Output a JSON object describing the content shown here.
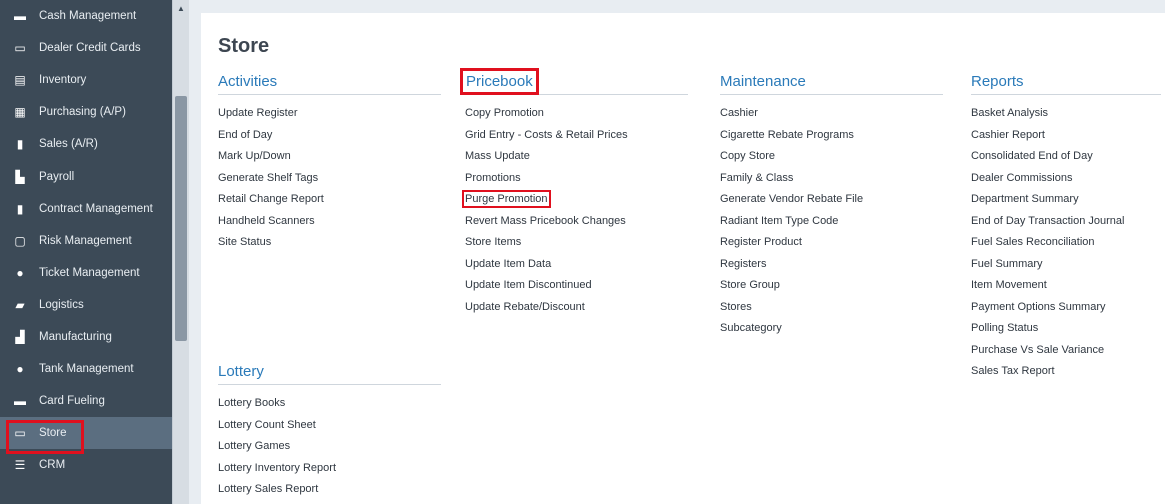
{
  "sidebar": {
    "items": [
      {
        "label": "Cash Management",
        "icon": "cash-icon",
        "glyph": "▬"
      },
      {
        "label": "Dealer Credit Cards",
        "icon": "credit-card-icon",
        "glyph": "▭"
      },
      {
        "label": "Inventory",
        "icon": "inventory-icon",
        "glyph": "▤"
      },
      {
        "label": "Purchasing (A/P)",
        "icon": "purchasing-icon",
        "glyph": "▦"
      },
      {
        "label": "Sales (A/R)",
        "icon": "sales-icon",
        "glyph": "▮"
      },
      {
        "label": "Payroll",
        "icon": "payroll-icon",
        "glyph": "▙"
      },
      {
        "label": "Contract Management",
        "icon": "contract-icon",
        "glyph": "▮"
      },
      {
        "label": "Risk Management",
        "icon": "risk-icon",
        "glyph": "▢"
      },
      {
        "label": "Ticket Management",
        "icon": "map-pin-icon",
        "glyph": "●"
      },
      {
        "label": "Logistics",
        "icon": "truck-icon",
        "glyph": "▰"
      },
      {
        "label": "Manufacturing",
        "icon": "factory-icon",
        "glyph": "▟"
      },
      {
        "label": "Tank Management",
        "icon": "fuel-drop-icon",
        "glyph": "●"
      },
      {
        "label": "Card Fueling",
        "icon": "card-icon",
        "glyph": "▬"
      },
      {
        "label": "Store",
        "icon": "store-icon",
        "glyph": "▭",
        "active": true
      },
      {
        "label": "CRM",
        "icon": "list-icon",
        "glyph": "☰"
      }
    ]
  },
  "page": {
    "title": "Store"
  },
  "sections": {
    "activities": {
      "title": "Activities",
      "links": [
        "Update Register",
        "End of Day",
        "Mark Up/Down",
        "Generate Shelf Tags",
        "Retail Change Report",
        "Handheld Scanners",
        "Site Status"
      ]
    },
    "pricebook": {
      "title": "Pricebook",
      "links": [
        "Copy Promotion",
        "Grid Entry - Costs & Retail Prices",
        "Mass Update",
        "Promotions",
        "Purge Promotion",
        "Revert Mass Pricebook Changes",
        "Store Items",
        "Update Item Data",
        "Update Item Discontinued",
        "Update Rebate/Discount"
      ]
    },
    "maintenance": {
      "title": "Maintenance",
      "links": [
        "Cashier",
        "Cigarette Rebate Programs",
        "Copy Store",
        "Family & Class",
        "Generate Vendor Rebate File",
        "Radiant Item Type Code",
        "Register Product",
        "Registers",
        "Store Group",
        "Stores",
        "Subcategory"
      ]
    },
    "reports": {
      "title": "Reports",
      "links": [
        "Basket Analysis",
        "Cashier Report",
        "Consolidated End of Day",
        "Dealer Commissions",
        "Department Summary",
        "End of Day Transaction Journal",
        "Fuel Sales Reconciliation",
        "Fuel Summary",
        "Item Movement",
        "Payment Options Summary",
        "Polling Status",
        "Purchase Vs Sale Variance",
        "Sales Tax Report"
      ]
    },
    "lottery": {
      "title": "Lottery",
      "links": [
        "Lottery Books",
        "Lottery Count Sheet",
        "Lottery Games",
        "Lottery Inventory Report",
        "Lottery Sales Report"
      ]
    }
  },
  "colors": {
    "accent": "#2a7ab9",
    "highlight": "#e0101e",
    "sidebar": "#3c4a57",
    "sidebar_active": "#5b6e80"
  }
}
